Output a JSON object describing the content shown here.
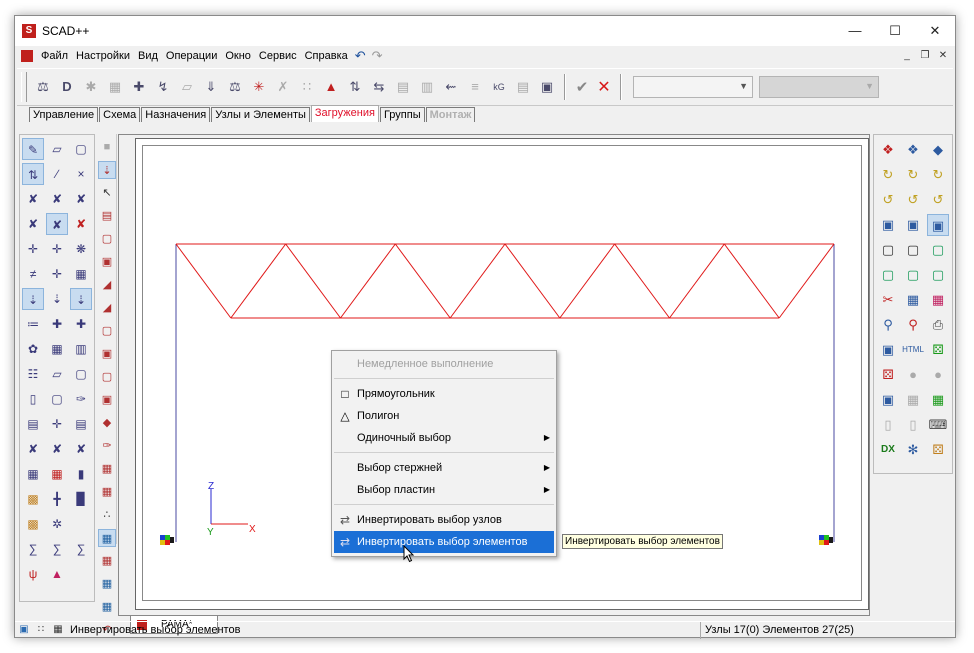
{
  "window": {
    "title": "SCAD++"
  },
  "menubar": {
    "items": [
      "Файл",
      "Настройки",
      "Вид",
      "Операции",
      "Окно",
      "Сервис",
      "Справка"
    ],
    "icons": [
      "undo-icon",
      "redo-icon"
    ]
  },
  "mdi_controls": [
    "minimize-icon",
    "restore-icon",
    "close-icon"
  ],
  "tabs": [
    {
      "label": "Управление",
      "state": "normal"
    },
    {
      "label": "Схема",
      "state": "normal"
    },
    {
      "label": "Назначения",
      "state": "normal"
    },
    {
      "label": "Узлы и Элементы",
      "state": "normal"
    },
    {
      "label": "Загружения",
      "state": "active"
    },
    {
      "label": "Группы",
      "state": "normal"
    },
    {
      "label": "Монтаж",
      "state": "disabled"
    }
  ],
  "canvas": {
    "axes": {
      "x": "X",
      "y": "Y",
      "z": "Z"
    },
    "colors": {
      "truss": "#e01818",
      "column": "#4a4aa0",
      "axis_x": "#e01818",
      "axis_y": "#1a9a1a",
      "axis_z": "#2a2ad0"
    }
  },
  "doc_tab": {
    "label": "РАМА*"
  },
  "context_menu": {
    "items": [
      {
        "label": "Немедленное выполнение",
        "state": "disabled",
        "icon": "",
        "submenu": false
      },
      {
        "label": "separator"
      },
      {
        "label": "Прямоугольник",
        "state": "normal",
        "icon": "rectangle-select-icon",
        "submenu": false
      },
      {
        "label": "Полигон",
        "state": "normal",
        "icon": "polygon-select-icon",
        "submenu": false
      },
      {
        "label": "Одиночный выбор",
        "state": "normal",
        "icon": "",
        "submenu": true
      },
      {
        "label": "separator"
      },
      {
        "label": "Выбор стержней",
        "state": "normal",
        "icon": "",
        "submenu": true
      },
      {
        "label": "Выбор пластин",
        "state": "normal",
        "icon": "",
        "submenu": true
      },
      {
        "label": "separator"
      },
      {
        "label": "Инвертировать выбор узлов",
        "state": "normal",
        "icon": "invert-nodes-icon",
        "submenu": false
      },
      {
        "label": "Инвертировать выбор  элементов",
        "state": "highlighted",
        "icon": "invert-elements-icon",
        "submenu": false
      }
    ]
  },
  "tooltip": {
    "text": "Инвертировать выбор  элементов"
  },
  "statusbar": {
    "text": "Инвертировать выбор  элементов",
    "right": "Узлы 17(0) Элементов 27(25)"
  }
}
